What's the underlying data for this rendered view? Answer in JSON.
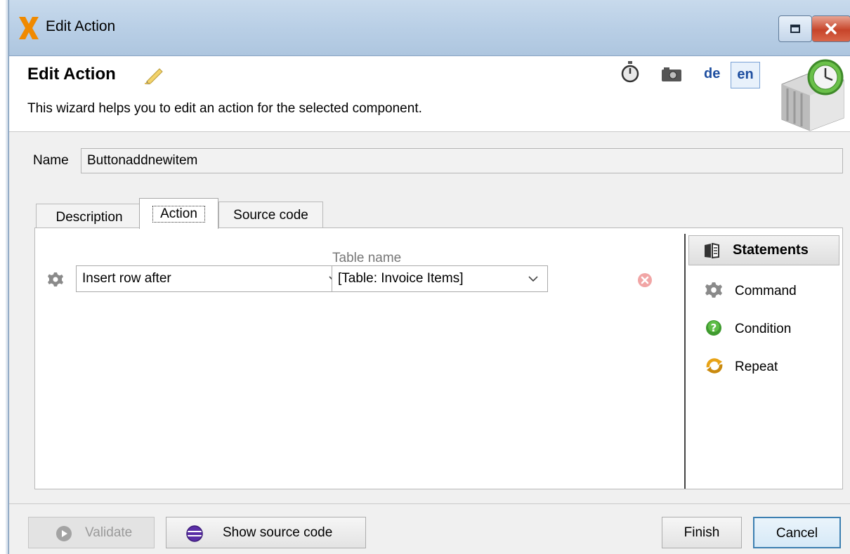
{
  "window": {
    "title": "Edit Action"
  },
  "header": {
    "title": "Edit Action",
    "description": "This wizard helps you to edit an action for the selected component.",
    "languages": [
      "de",
      "en"
    ],
    "active_language": "en"
  },
  "form": {
    "name_label": "Name",
    "name_value": "Buttonaddnewitem"
  },
  "tabs": [
    {
      "label": "Description"
    },
    {
      "label": "Action"
    },
    {
      "label": "Source code"
    }
  ],
  "action": {
    "command_value": "Insert row after",
    "table_name_label": "Table name",
    "table_name_value": "[Table: Invoice Items]"
  },
  "statements": {
    "header": "Statements",
    "items": [
      {
        "label": "Command",
        "icon": "gear-icon"
      },
      {
        "label": "Condition",
        "icon": "question-icon"
      },
      {
        "label": "Repeat",
        "icon": "repeat-icon"
      }
    ]
  },
  "footer": {
    "validate_label": "Validate",
    "show_source_label": "Show source code",
    "finish_label": "Finish",
    "cancel_label": "Cancel"
  },
  "colors": {
    "titlebar": "#b9cfe6",
    "accent_blue": "#1f4fa0",
    "close_red": "#c7452a",
    "cancel_border": "#3c7fb1"
  }
}
